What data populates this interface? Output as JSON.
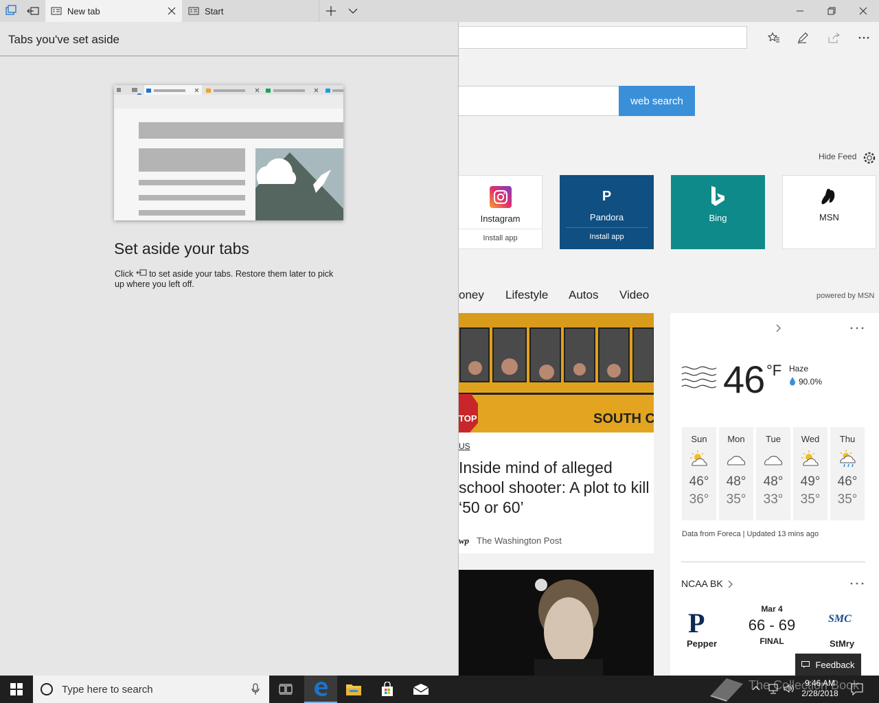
{
  "titlebar": {
    "tabs": [
      {
        "label": "New tab"
      },
      {
        "label": "Start"
      }
    ]
  },
  "aside_panel": {
    "title": "Tabs you've set aside",
    "heading": "Set aside your tabs",
    "desc_before": "Click",
    "desc_after": "to set aside your tabs. Restore them later to pick up where you left off."
  },
  "search": {
    "button_label": "web search"
  },
  "feed": {
    "hide_feed_label": "Hide Feed",
    "powered_by": "powered by MSN",
    "categories": [
      "oney",
      "Lifestyle",
      "Autos",
      "Video"
    ]
  },
  "tiles": [
    {
      "name": "Instagram",
      "sub": "Install app",
      "icon": "instagram-icon"
    },
    {
      "name": "Pandora",
      "sub": "Install app",
      "icon": "pandora-icon",
      "glyph": "P"
    },
    {
      "name": "Bing",
      "sub": "",
      "icon": "bing-icon"
    },
    {
      "name": "MSN",
      "sub": "",
      "icon": "msn-icon"
    }
  ],
  "news": {
    "category": "US",
    "title": "Inside mind of alleged school shooter: A plot to kill ‘50 or 60’",
    "source": "The Washington Post",
    "source_logo": "wp",
    "bus_text": "SOUTH CAROLI",
    "stop_text": "TOP"
  },
  "weather": {
    "temp": "46",
    "unit": "°F",
    "condition": "Haze",
    "humidity": "90.0%",
    "source": "Data from Foreca | Updated 13 mins ago",
    "forecast": [
      {
        "day": "Sun",
        "hi": "46°",
        "lo": "36°",
        "icon": "partly-sunny-icon"
      },
      {
        "day": "Mon",
        "hi": "48°",
        "lo": "35°",
        "icon": "cloudy-icon"
      },
      {
        "day": "Tue",
        "hi": "48°",
        "lo": "33°",
        "icon": "cloudy-icon"
      },
      {
        "day": "Wed",
        "hi": "49°",
        "lo": "35°",
        "icon": "partly-sunny-icon"
      },
      {
        "day": "Thu",
        "hi": "46°",
        "lo": "35°",
        "icon": "sun-rain-icon"
      }
    ]
  },
  "sports": {
    "league": "NCAA BK",
    "date": "Mar 4",
    "score": "66 - 69",
    "status": "FINAL",
    "team1": "Pepper",
    "team1_logo": "P",
    "team2": "StMry",
    "team2_logo": "SMC"
  },
  "feedback_label": "Feedback",
  "taskbar": {
    "search_placeholder": "Type here to search",
    "time": "9:46 AM",
    "date": "2/28/2018",
    "watermark": "The Collection Book"
  },
  "colors": {
    "accent_blue": "#3a8fd9",
    "pandora": "#0f4f82",
    "bing": "#0f8a8a",
    "edge_blue": "#1e73c8"
  }
}
